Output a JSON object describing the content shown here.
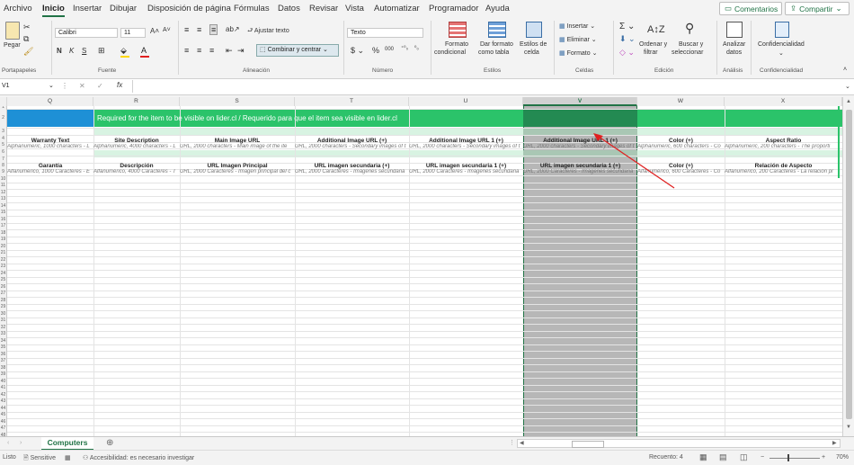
{
  "menu": {
    "tabs": [
      "Archivo",
      "Inicio",
      "Insertar",
      "Dibujar",
      "Disposición de página",
      "Fórmulas",
      "Datos",
      "Revisar",
      "Vista",
      "Automatizar",
      "Programador",
      "Ayuda"
    ],
    "comments_label": "Comentarios",
    "share_label": "Compartir"
  },
  "ribbon": {
    "paste_label": "Pegar",
    "font_name": "Calibri",
    "font_size": "11",
    "wrap_text": "Ajustar texto",
    "merge_center": "Combinar y centrar",
    "number_format": "Texto",
    "cond_format_1": "Formato",
    "cond_format_2": "condicional",
    "table_format_1": "Dar formato",
    "table_format_2": "como tabla",
    "cell_styles_1": "Estilos de",
    "cell_styles_2": "celda",
    "insert": "Insertar",
    "delete": "Eliminar",
    "format": "Formato",
    "sort_1": "Ordenar y",
    "sort_2": "filtrar",
    "find_1": "Buscar y",
    "find_2": "seleccionar",
    "analyze_1": "Analizar",
    "analyze_2": "datos",
    "sensitivity": "Confidencialidad",
    "groups": [
      "Portapapeles",
      "Fuente",
      "Alineación",
      "Número",
      "Estilos",
      "Celdas",
      "Edición",
      "Análisis",
      "Confidencialidad"
    ],
    "bold": "N",
    "italic": "K",
    "underline": "S"
  },
  "formula_bar": {
    "name_box": "V1",
    "fx": "fx",
    "value": ""
  },
  "columns": [
    "Q",
    "R",
    "S",
    "T",
    "U",
    "V",
    "W",
    "X"
  ],
  "row_numbers": [
    "1",
    "2",
    "3",
    "4",
    "5",
    "6",
    "7",
    "8",
    "9",
    "10",
    "11",
    "12",
    "13",
    "14",
    "15",
    "16",
    "17",
    "18",
    "19",
    "20",
    "21",
    "22",
    "23",
    "24",
    "25",
    "26",
    "27",
    "28",
    "29",
    "30",
    "31",
    "32",
    "33",
    "34",
    "35",
    "36",
    "37",
    "38",
    "39",
    "40",
    "41",
    "42",
    "43",
    "44",
    "45",
    "46",
    "47",
    "48",
    "49",
    "50",
    "51"
  ],
  "banner_text": "Required for the item to be visible on lider.cl / Requerido para que el item sea visible en lider.cl",
  "row4_headers": [
    "Warranty Text",
    "Site Description",
    "Main Image URL",
    "Additional Image URL (+)",
    "Additional Image URL 1 (+)",
    "Additional Image URL 1 (+)",
    "Color (+)",
    "Aspect Ratio"
  ],
  "row5_desc": [
    "Alphanumeric, 1000 characters - L",
    "Alphanumeric, 4000 characters - L",
    "URL, 2000 characters - Main image of the ite",
    "URL, 2000 characters - Secondary images of t",
    "URL, 2000 characters - Secondary images of t",
    "URL, 2000 characters - Secondary images of t",
    "Alphanumeric, 600 characters - Co",
    "Alphanumeric, 200 characters - The proporti"
  ],
  "row7_headers": [
    "Garantía",
    "Descripción",
    "URL Imagen Principal",
    "URL imagen secundaria (+)",
    "URL imagen secundaria 1 (+)",
    "URL imagen secundaria 1 (+)",
    "Color (+)",
    "Relación de Aspecto"
  ],
  "row8_desc": [
    "Alfanumérico, 1000 Caracteres - E",
    "Alfanumérico, 4000 Caracteres - T",
    "URL, 2000 Caracteres - Imagen principal del c",
    "URL, 2000 Caracteres - Imágenes secundaria",
    "URL, 2000 Caracteres - Imágenes secundaria",
    "URL, 2000 Caracteres - Imágenes secundaria",
    "Alfanumérico, 600 Caracteres - Co",
    "Alfanumérico, 200 Caracteres - La relación pr"
  ],
  "sheet_tab": "Computers",
  "status": {
    "ready": "Listo",
    "sensitive": "Sensitive",
    "accessibility": "Accesibilidad: es necesario investigar",
    "count": "Recuento: 4",
    "zoom": "70%"
  },
  "colors": {
    "accent": "#217346",
    "banner_green": "#2bc36a",
    "banner_blue": "#1e90d6",
    "selected_column": "#b7b7b7",
    "arrow": "#e02020"
  }
}
